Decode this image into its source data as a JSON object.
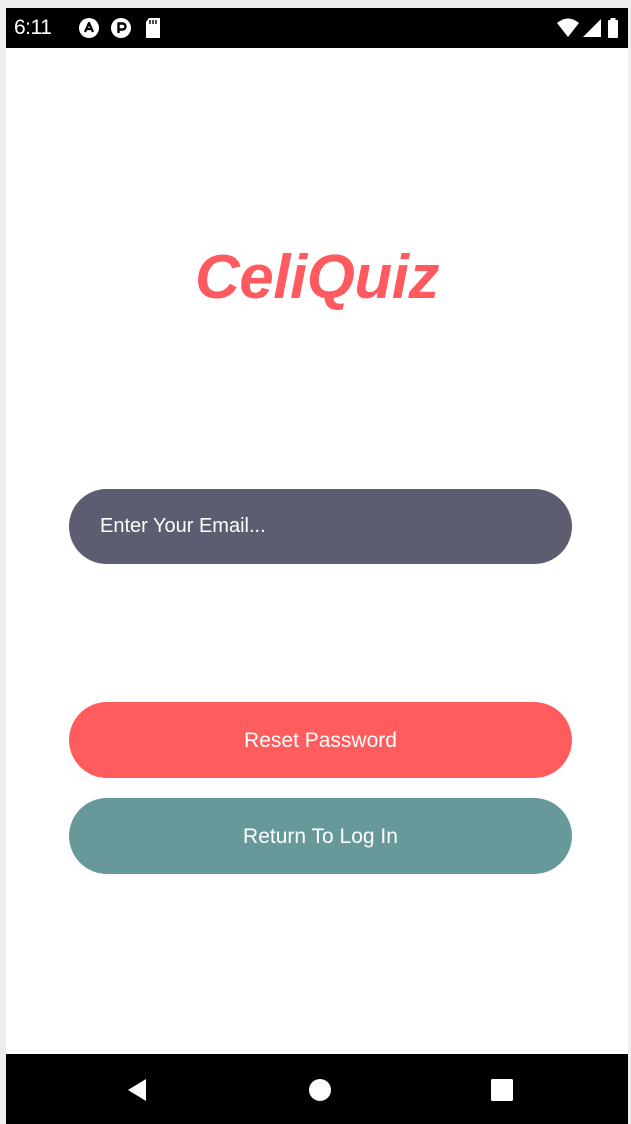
{
  "status_bar": {
    "time": "6:11",
    "left_icons": [
      "notification-a-icon",
      "notification-p-icon",
      "sd-card-icon"
    ],
    "right_icons": [
      "wifi-icon",
      "cell-signal-icon",
      "battery-icon"
    ]
  },
  "app": {
    "logo_text": "CeliQuiz",
    "brand_color": "#ff5a5f"
  },
  "form": {
    "email_placeholder": "Enter Your Email...",
    "email_value": "",
    "reset_label": "Reset Password",
    "return_label": "Return To Log In"
  },
  "colors": {
    "input_bg": "#5d5d72",
    "reset_bg": "#ff5d5d",
    "return_bg": "#67999a"
  },
  "nav_bar": {
    "buttons": [
      "back-icon",
      "home-icon",
      "recents-icon"
    ]
  }
}
